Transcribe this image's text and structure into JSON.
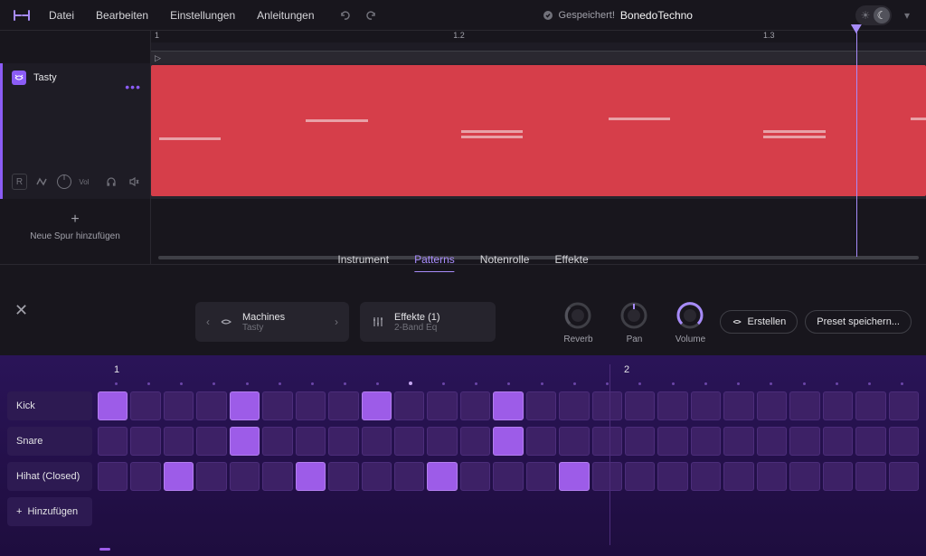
{
  "menu": {
    "file": "Datei",
    "edit": "Bearbeiten",
    "settings": "Einstellungen",
    "help": "Anleitungen"
  },
  "header": {
    "saved_label": "Gespeichert!",
    "project_name": "BonedoTechno"
  },
  "ruler": {
    "m1": "1",
    "m2": "1.2",
    "m3": "1.3"
  },
  "track": {
    "name": "Tasty",
    "record": "R",
    "vol": "Vol"
  },
  "add_track_label": "Neue Spur hinzufügen",
  "tabs": {
    "instrument": "Instrument",
    "patterns": "Patterns",
    "notenrolle": "Notenrolle",
    "effekte": "Effekte"
  },
  "machine_selector": {
    "title": "Machines",
    "sub": "Tasty"
  },
  "fx_selector": {
    "title": "Effekte (1)",
    "sub": "2-Band Eq"
  },
  "knobs": {
    "reverb": "Reverb",
    "pan": "Pan",
    "volume": "Volume"
  },
  "buttons": {
    "create": "Erstellen",
    "save_preset": "Preset speichern..."
  },
  "seq": {
    "beat1": "1",
    "beat2": "2",
    "rows": {
      "kick": "Kick",
      "snare": "Snare",
      "hihat": "Hihat (Closed)",
      "add": "Hinzufügen"
    },
    "pattern": {
      "kick": [
        1,
        0,
        0,
        0,
        1,
        0,
        0,
        0,
        1,
        0,
        0,
        0,
        1,
        0,
        0,
        0,
        0,
        0,
        0,
        0,
        0,
        0,
        0,
        0,
        0
      ],
      "snare": [
        0,
        0,
        0,
        0,
        1,
        0,
        0,
        0,
        0,
        0,
        0,
        0,
        1,
        0,
        0,
        0,
        0,
        0,
        0,
        0,
        0,
        0,
        0,
        0,
        0
      ],
      "hihat": [
        0,
        0,
        1,
        0,
        0,
        0,
        1,
        0,
        0,
        0,
        1,
        0,
        0,
        0,
        1,
        0,
        0,
        0,
        0,
        0,
        0,
        0,
        0,
        0,
        0
      ]
    }
  }
}
